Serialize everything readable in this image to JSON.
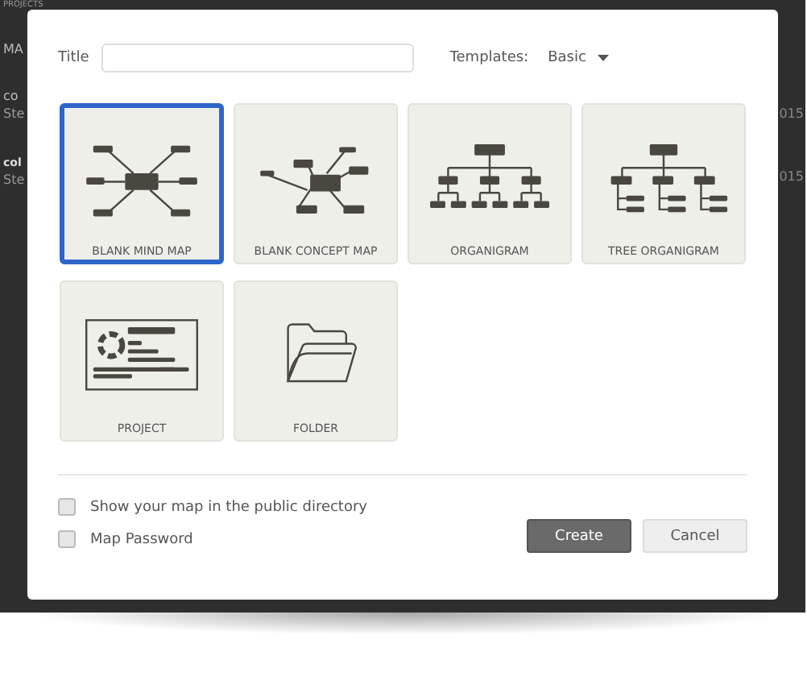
{
  "background": {
    "heading": "PROJECTS",
    "section": "MA",
    "items": [
      {
        "title": "co",
        "subtitle": "Ste",
        "date": "015",
        "bold": false
      },
      {
        "title": "col",
        "subtitle": "Ste",
        "date": "015",
        "bold": true
      }
    ]
  },
  "dialog": {
    "title_label": "Title",
    "templates_label": "Templates:",
    "templates_value": "Basic",
    "tiles": [
      {
        "kind": "mind-map",
        "label": "BLANK MIND MAP",
        "selected": true
      },
      {
        "kind": "concept-map",
        "label": "BLANK CONCEPT MAP",
        "selected": false
      },
      {
        "kind": "organigram",
        "label": "ORGANIGRAM",
        "selected": false
      },
      {
        "kind": "tree-organigram",
        "label": "TREE ORGANIGRAM",
        "selected": false
      },
      {
        "kind": "project",
        "label": "PROJECT",
        "selected": false
      },
      {
        "kind": "folder",
        "label": "FOLDER",
        "selected": false
      }
    ],
    "options": [
      {
        "label": "Show your map in the public directory",
        "checked": false
      },
      {
        "label": "Map Password",
        "checked": false
      }
    ],
    "buttons": [
      {
        "kind": "primary",
        "label": "Create"
      },
      {
        "kind": "secondary",
        "label": "Cancel"
      }
    ]
  }
}
